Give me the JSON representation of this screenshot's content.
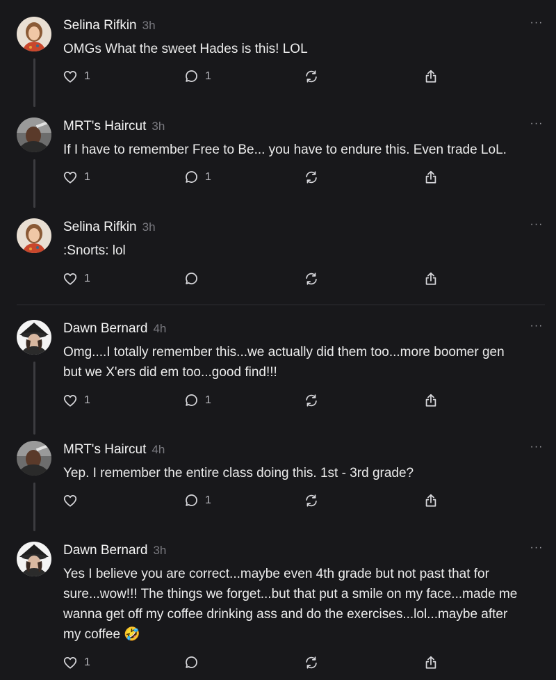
{
  "posts": [
    {
      "author": "Selina Rifkin",
      "time": "3h",
      "text": "OMGs What the sweet Hades is this! LOL",
      "avatar": "selina-avatar",
      "likes": "1",
      "replies": "1"
    },
    {
      "author": "MRT's Haircut",
      "time": "3h",
      "text": "If I have to remember Free to Be... you have to endure this. Even trade LoL.",
      "avatar": "mrt-avatar",
      "likes": "1",
      "replies": "1"
    },
    {
      "author": "Selina Rifkin",
      "time": "3h",
      "text": ":Snorts: lol",
      "avatar": "selina-avatar",
      "likes": "1",
      "replies": ""
    },
    {
      "author": "Dawn Bernard",
      "time": "4h",
      "text": "Omg....I totally remember this...we actually did them too...more boomer gen\nbut we X'ers did em too...good find!!!",
      "avatar": "dawn-avatar",
      "likes": "1",
      "replies": "1"
    },
    {
      "author": "MRT's Haircut",
      "time": "4h",
      "text": "Yep. I remember the entire class doing this. 1st - 3rd grade?",
      "avatar": "mrt-avatar",
      "likes": "",
      "replies": "1"
    },
    {
      "author": "Dawn Bernard",
      "time": "3h",
      "text": "Yes I believe you are correct...maybe even 4th grade but not past that for\nsure...wow!!! The things we forget...but that put a smile on my face...made me\nwanna get off my coffee drinking ass and do the exercises...lol...maybe after\nmy coffee 🤣",
      "avatar": "dawn-avatar",
      "likes": "1",
      "replies": ""
    }
  ],
  "more_label": "···",
  "icons": {
    "like": "heart-icon",
    "reply": "comment-icon",
    "repost": "repost-icon",
    "share": "share-icon",
    "more": "more-options-icon"
  },
  "colors": {
    "background": "#18181b",
    "text": "#f2f2f2",
    "muted": "#7a7a80",
    "thread_line": "#3c3c40"
  }
}
